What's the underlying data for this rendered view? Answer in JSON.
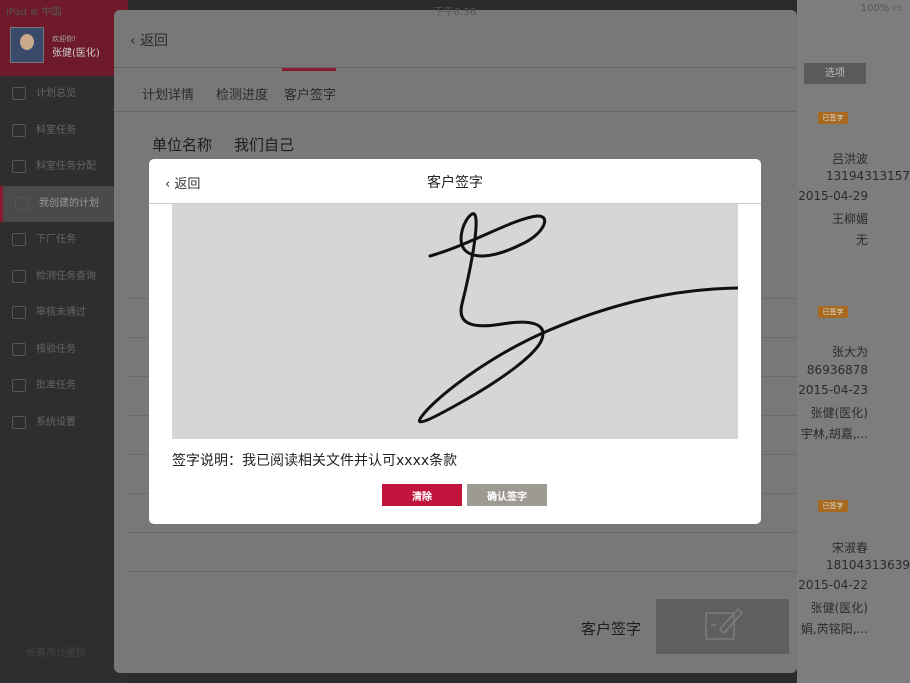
{
  "status_bar": {
    "device": "iPad",
    "signal": "中国",
    "time": "下午8:56",
    "battery": "100%"
  },
  "sidebar": {
    "welcome": "欢迎你!",
    "user": "张健(医化)",
    "items": [
      {
        "label": "计划总览",
        "icon": "upload-icon"
      },
      {
        "label": "科室任务",
        "icon": "wallet-icon"
      },
      {
        "label": "科室任务分配",
        "icon": "inbox-icon"
      },
      {
        "label": "我创建的计划",
        "icon": "edit-icon",
        "active": true
      },
      {
        "label": "下厂任务",
        "icon": "camera-icon"
      },
      {
        "label": "检测任务查询",
        "icon": "query-icon"
      },
      {
        "label": "审核未通过",
        "icon": "return-icon"
      },
      {
        "label": "核验任务",
        "icon": "info-icon"
      },
      {
        "label": "批准任务",
        "icon": "stamp-icon"
      },
      {
        "label": "系统设置",
        "icon": "gear-icon"
      }
    ],
    "org": "长春市计量院"
  },
  "right_panel": {
    "options_label": "选项",
    "cards": [
      {
        "tag": "已签字",
        "lines": [
          "吕洪波",
          "13194313157",
          "2015-04-29",
          "王柳媚",
          "无"
        ]
      },
      {
        "tag": "已签字",
        "lines": [
          "张大为",
          "86936878",
          "2015-04-23",
          "张健(医化)",
          "宇林,胡嘉,..."
        ]
      },
      {
        "tag": "已签字",
        "lines": [
          "宋淑春",
          "18104313639",
          "2015-04-22",
          "张健(医化)",
          "娟,芮铭阳,..."
        ]
      }
    ]
  },
  "modal": {
    "back_label": "返回",
    "tabs": [
      "计划详情",
      "检测进度",
      "客户签字"
    ],
    "active_tab": 2,
    "unit_label": "单位名称",
    "unit_value": "我们自己",
    "signature_label": "客户签字"
  },
  "dialog": {
    "back_label": "返回",
    "title": "客户签字",
    "note": "签字说明：我已阅读相关文件并认可xxxx条款",
    "clear_label": "清除",
    "confirm_label": "确认签字"
  },
  "colors": {
    "accent": "#c0143c",
    "confirm": "#9d9a92",
    "sidebar_header": "#6e1a2a",
    "pad_bg": "#d6d6d6"
  }
}
